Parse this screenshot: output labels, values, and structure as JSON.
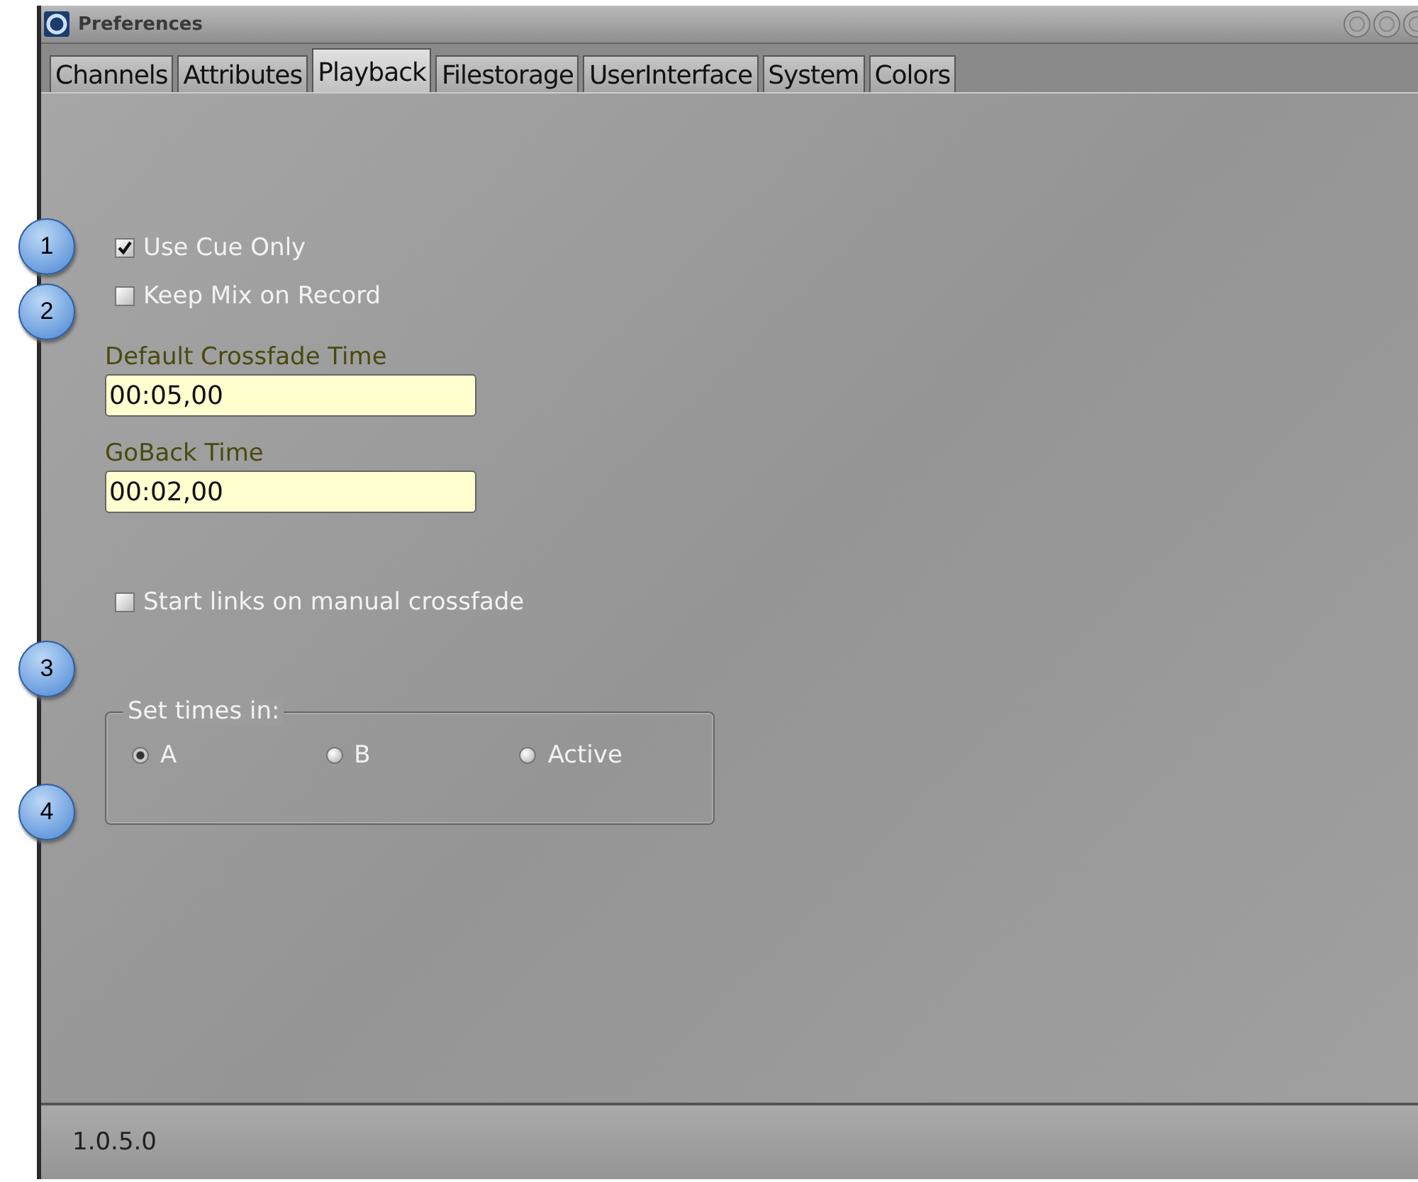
{
  "window": {
    "title": "Preferences"
  },
  "tabs": [
    {
      "label": "Channels",
      "selected": false
    },
    {
      "label": "Attributes",
      "selected": false
    },
    {
      "label": "Playback",
      "selected": true
    },
    {
      "label": "Filestorage",
      "selected": false
    },
    {
      "label": "UserInterface",
      "selected": false
    },
    {
      "label": "System",
      "selected": false
    },
    {
      "label": "Colors",
      "selected": false
    }
  ],
  "options": [
    {
      "label": "Use Cue Only",
      "checked": true
    },
    {
      "label": "Keep Mix on Record",
      "checked": false
    }
  ],
  "fields": [
    {
      "label": "Default Crossfade Time",
      "value": "00:05,00"
    },
    {
      "label": "GoBack Time",
      "value": "00:02,00"
    }
  ],
  "link_option": {
    "label": "Start links on manual crossfade",
    "checked": false
  },
  "set_times": {
    "title": "Set times in:",
    "choices": [
      {
        "label": "A",
        "selected": true
      },
      {
        "label": "B",
        "selected": false
      },
      {
        "label": "Active",
        "selected": false
      }
    ]
  },
  "callouts": [
    "1",
    "2",
    "3",
    "4"
  ],
  "status_bar": {
    "version": "1.0.5.0"
  }
}
